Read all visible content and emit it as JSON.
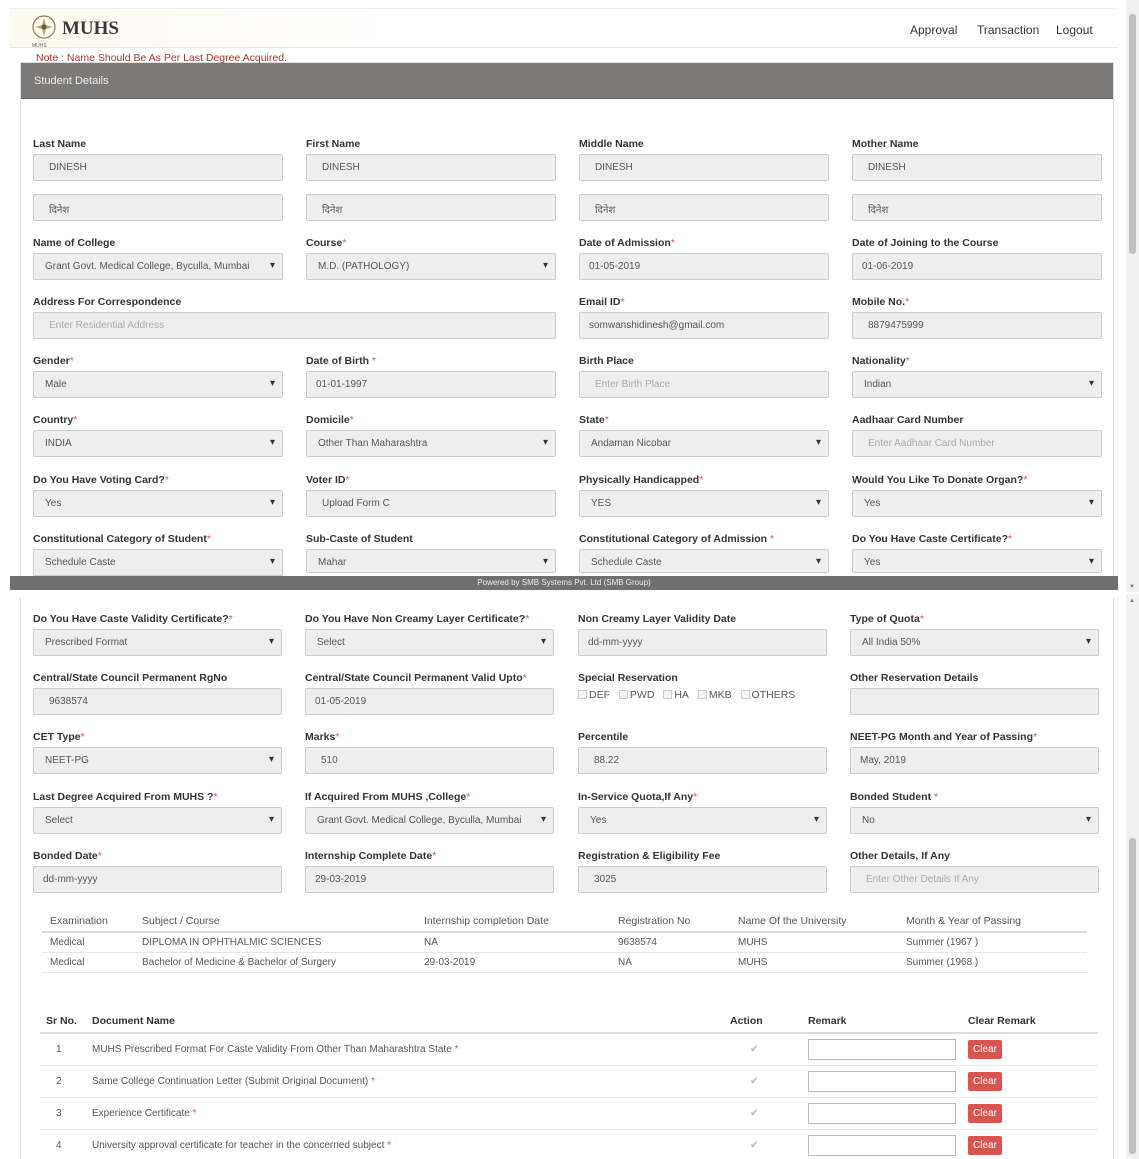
{
  "brand": "MUHS",
  "logo_caption": "MUHS",
  "nav": [
    "Approval",
    "Transaction",
    "Logout"
  ],
  "panel_title": "Student Details",
  "note": "Note : Name Should Be As Per Last Degree Acquired.",
  "footer": "Powered by SMB Systems Pvt. Ltd (SMB Group)",
  "name_row": [
    {
      "label": "Last Name",
      "value": "DINESH",
      "marathi": "दिनेश"
    },
    {
      "label": "First Name",
      "value": "DINESH",
      "marathi": "दिनेश"
    },
    {
      "label": "Middle Name",
      "value": "DINESH",
      "marathi": "दिनेश"
    },
    {
      "label": "Mother Name",
      "value": "DINESH",
      "marathi": "दिनेश"
    }
  ],
  "fields": {
    "college": {
      "label": "Name of College",
      "value": "Grant Govt. Medical College, Byculla, Mumbai"
    },
    "course": {
      "label": "Course",
      "value": "M.D. (PATHOLOGY)"
    },
    "admission_date": {
      "label": "Date of Admission",
      "value": "01-05-2019"
    },
    "joining_date": {
      "label": "Date of Joining to the Course",
      "value": "01-06-2019"
    },
    "address": {
      "label": "Address For Correspondence",
      "placeholder": "Enter Residential Address"
    },
    "email": {
      "label": "Email ID",
      "value": "somwanshidinesh@gmail.com"
    },
    "mobile": {
      "label": "Mobile No.",
      "value": "8879475999"
    },
    "gender": {
      "label": "Gender",
      "value": "Male"
    },
    "dob": {
      "label": "Date of Birth",
      "value": "01-01-1997"
    },
    "birth_place": {
      "label": "Birth Place",
      "placeholder": "Enter Birth Place"
    },
    "nationality": {
      "label": "Nationality",
      "value": "Indian"
    },
    "country": {
      "label": "Country",
      "value": "INDIA"
    },
    "domicile": {
      "label": "Domicile",
      "value": "Other Than Maharashtra"
    },
    "state": {
      "label": "State",
      "value": "Andaman Nicobar"
    },
    "aadhaar": {
      "label": "Aadhaar Card Number",
      "placeholder": "Enter Aadhaar Card Number"
    },
    "voting_card": {
      "label": "Do You Have Voting Card?",
      "value": "Yes"
    },
    "voter_id": {
      "label": "Voter ID",
      "value": "Upload Form C"
    },
    "handicapped": {
      "label": "Physically Handicapped",
      "value": "YES"
    },
    "donate_organ": {
      "label": "Would You Like To Donate Organ?",
      "value": "Yes"
    },
    "category_student": {
      "label": "Constitutional Category of Student",
      "value": "Schedule Caste"
    },
    "subcaste": {
      "label": "Sub-Caste of Student",
      "value": "Mahar"
    },
    "category_admission": {
      "label": "Constitutional Category of Admission",
      "value": "Schedule Caste"
    },
    "caste_cert": {
      "label": "Do You Have Caste Certificate?",
      "value": "Yes"
    },
    "caste_validity": {
      "label": "Do You Have Caste Validity Certificate?",
      "value": "Prescribed Format"
    },
    "non_creamy": {
      "label": "Do You Have Non Creamy Layer Certificate?",
      "value": "Select"
    },
    "non_creamy_date": {
      "label": "Non Creamy Layer Validity Date",
      "value": "dd-mm-yyyy"
    },
    "quota": {
      "label": "Type of Quota",
      "value": "All India 50%"
    },
    "council_reg": {
      "label": "Central/State Council Permanent RgNo",
      "value": "9638574"
    },
    "council_valid": {
      "label": "Central/State Council Permanent Valid Upto",
      "value": "01-05-2019"
    },
    "special_res": {
      "label": "Special Reservation",
      "options": [
        "DEF",
        "PWD",
        "HA",
        "MKB",
        "OTHERS"
      ]
    },
    "other_res": {
      "label": "Other Reservation Details",
      "value": ""
    },
    "cet_type": {
      "label": "CET Type",
      "value": "NEET-PG"
    },
    "marks": {
      "label": "Marks",
      "value": "510"
    },
    "percentile": {
      "label": "Percentile",
      "value": "88.22"
    },
    "neet_pass": {
      "label": "NEET-PG Month and Year of Passing",
      "value": "May, 2019"
    },
    "last_degree": {
      "label": "Last Degree Acquired From MUHS ?",
      "value": "Select"
    },
    "acq_college": {
      "label": "If Acquired From MUHS ,College",
      "value": "Grant Govt. Medical College, Byculla, Mumbai"
    },
    "inservice": {
      "label": "In-Service Quota,If Any",
      "value": "Yes"
    },
    "bonded": {
      "label": "Bonded Student",
      "value": "No"
    },
    "bonded_date": {
      "label": "Bonded Date",
      "value": "dd-mm-yyyy"
    },
    "internship_date": {
      "label": "Internship Complete Date",
      "value": "29-03-2019"
    },
    "fee": {
      "label": "Registration & Eligibility Fee",
      "value": "3025"
    },
    "other_details": {
      "label": "Other Details, If Any",
      "placeholder": "Enter Other Details If Any"
    }
  },
  "exam_table": {
    "headers": [
      "Examination",
      "Subject / Course",
      "Internship completion Date",
      "Registration No",
      "Name Of the University",
      "Month & Year of Passing"
    ],
    "rows": [
      [
        "Medical",
        "DIPLOMA IN OPHTHALMIC SCIENCES",
        "NA",
        "9638574",
        "MUHS",
        "Summer (1967 )"
      ],
      [
        "Medical",
        "Bachelor of Medicine & Bachelor of Surgery",
        "29-03-2019",
        "NA",
        "MUHS",
        "Summer (1968 )"
      ]
    ]
  },
  "doc_table": {
    "headers": [
      "Sr No.",
      "Document Name",
      "Action",
      "Remark",
      "Clear Remark"
    ],
    "clear_label": "Clear",
    "rows": [
      {
        "sr": "1",
        "name": "MUHS Prescribed Format For Caste Validity From Other Than Maharashtra State"
      },
      {
        "sr": "2",
        "name": "Same College Continuation Letter (Submit Original Document)"
      },
      {
        "sr": "3",
        "name": "Experience Certificate"
      },
      {
        "sr": "4",
        "name": "University approval certificate for teacher in the concerned subject"
      }
    ]
  }
}
